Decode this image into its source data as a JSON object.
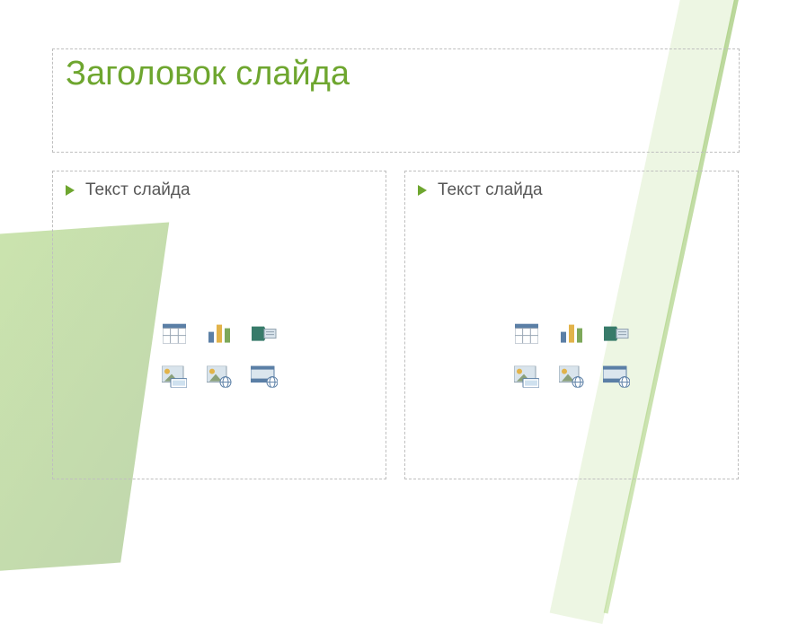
{
  "theme": {
    "accent": "#6ea62f",
    "text": "#575757",
    "dashed_border": "#bfbfbf"
  },
  "title_placeholder": {
    "text": "Заголовок слайда"
  },
  "content_left": {
    "bullet_text": "Текст слайда",
    "insert_icons": {
      "table": "insert-table",
      "chart": "insert-chart",
      "smartart": "insert-smartart",
      "picture": "insert-picture",
      "online_image": "insert-online-picture",
      "video": "insert-online-video"
    }
  },
  "content_right": {
    "bullet_text": "Текст слайда",
    "insert_icons": {
      "table": "insert-table",
      "chart": "insert-chart",
      "smartart": "insert-smartart",
      "picture": "insert-picture",
      "online_image": "insert-online-picture",
      "video": "insert-online-video"
    }
  }
}
